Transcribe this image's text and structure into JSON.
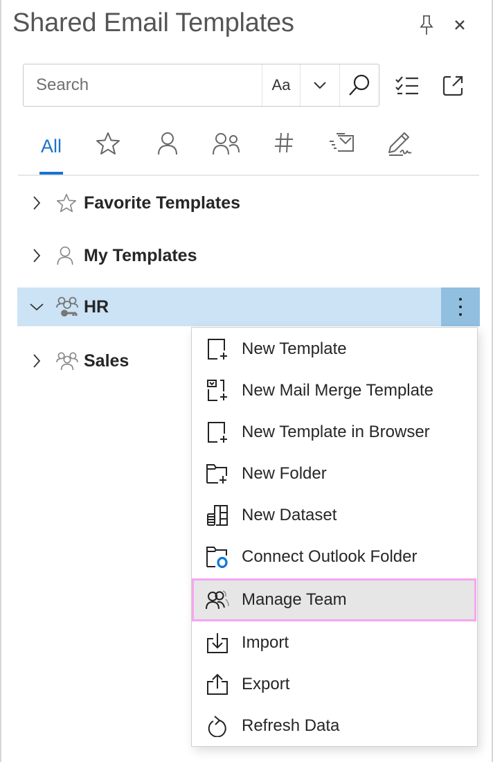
{
  "header": {
    "title": "Shared Email Templates",
    "pin_icon": "pin-icon",
    "close_icon": "close-icon"
  },
  "search": {
    "placeholder": "Search",
    "value": "",
    "match_case_label": "Aa",
    "dropdown_icon": "chevron-down-icon",
    "search_icon": "search-icon"
  },
  "toolbar": {
    "select_icon": "checklist-icon",
    "popout_icon": "open-external-icon"
  },
  "tabs": [
    {
      "label": "All",
      "icon": null,
      "active": true
    },
    {
      "label": "Favorites",
      "icon": "star-icon",
      "active": false
    },
    {
      "label": "My",
      "icon": "person-icon",
      "active": false
    },
    {
      "label": "Shared",
      "icon": "people-icon",
      "active": false
    },
    {
      "label": "Hashtags",
      "icon": "hashtag-icon",
      "active": false
    },
    {
      "label": "Mail Merge",
      "icon": "mail-merge-icon",
      "active": false
    },
    {
      "label": "Signatures",
      "icon": "signature-icon",
      "active": false
    }
  ],
  "tree": [
    {
      "label": "Favorite Templates",
      "icon": "star-icon",
      "expanded": false,
      "selected": false
    },
    {
      "label": "My Templates",
      "icon": "person-icon",
      "expanded": false,
      "selected": false
    },
    {
      "label": "HR",
      "icon": "team-owner-icon",
      "expanded": true,
      "selected": true
    },
    {
      "label": "Sales",
      "icon": "team-icon",
      "expanded": false,
      "selected": false
    }
  ],
  "context_menu": {
    "items": [
      {
        "label": "New Template",
        "icon": "new-template-icon"
      },
      {
        "label": "New Mail Merge Template",
        "icon": "new-mail-merge-icon"
      },
      {
        "label": "New Template in Browser",
        "icon": "new-template-browser-icon"
      },
      {
        "label": "New Folder",
        "icon": "new-folder-icon"
      },
      {
        "label": "New Dataset",
        "icon": "dataset-icon"
      },
      {
        "label": "Connect Outlook Folder",
        "icon": "outlook-folder-icon"
      },
      {
        "label": "Manage Team",
        "icon": "manage-team-icon",
        "hovered": true
      },
      {
        "label": "Import",
        "icon": "import-icon"
      },
      {
        "label": "Export",
        "icon": "export-icon"
      },
      {
        "label": "Refresh Data",
        "icon": "refresh-icon"
      }
    ]
  },
  "colors": {
    "accent": "#1574d0",
    "selected_row": "#cce3f5",
    "more_button": "#91bfe0",
    "hover_item": "#e6e6e6",
    "highlight_outline": "#f6a5ef",
    "outlook_blue": "#0f78d4"
  }
}
